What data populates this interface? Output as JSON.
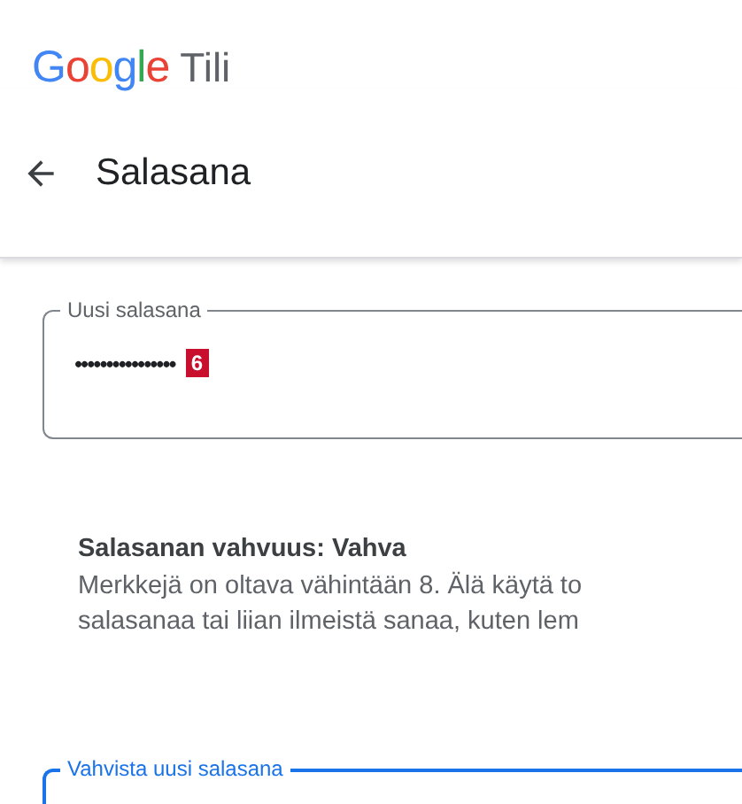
{
  "header": {
    "logo": "Google",
    "title": "Tili"
  },
  "page": {
    "title": "Salasana"
  },
  "fields": [
    {
      "label": "Uusi salasana",
      "value": "••••••••••••••••",
      "badge": "6",
      "focused": false
    },
    {
      "label": "Vahvista uusi salasana",
      "focused": true
    }
  ],
  "strength": {
    "text": "Salasanan vahvuus: Vahva",
    "hint_lines": [
      "Merkkejä on oltava vähintään 8. Älä käytä to",
      "salasanaa tai liian ilmeistä sanaa, kuten lem"
    ]
  }
}
